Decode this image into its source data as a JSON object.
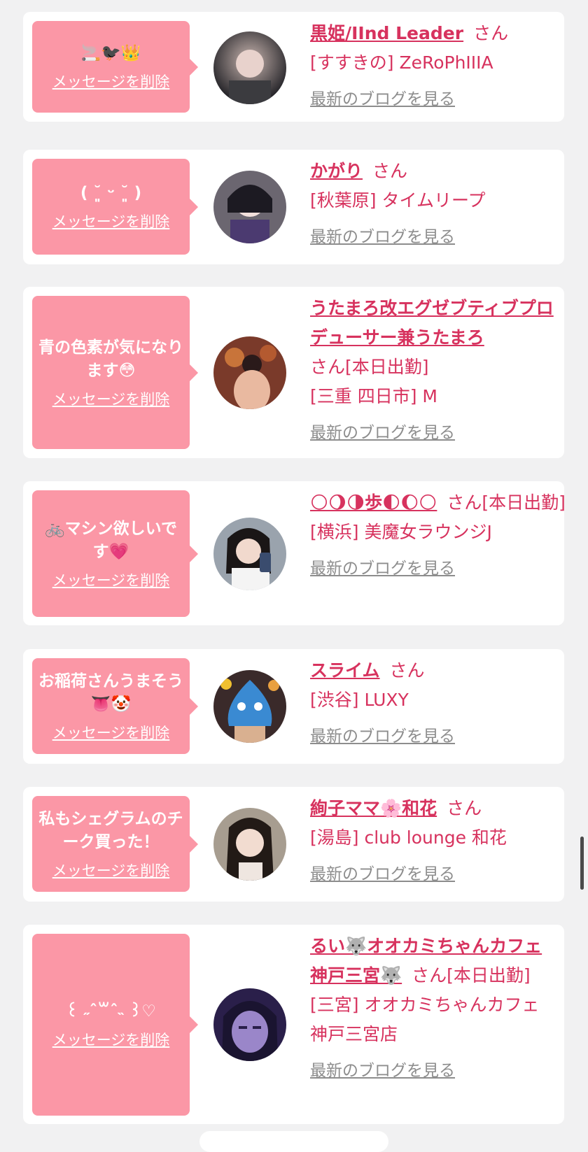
{
  "delete_label": "メッセージを削除",
  "blog_label": "最新のブログを見る",
  "cards": [
    {
      "message": "🚬🐦‍⬛👑",
      "name": "黒姫/IInd Leader",
      "san": "さん",
      "status": "",
      "shop": "[すすきの] ZeRoPhIIIA"
    },
    {
      "message": "( ˘͈ ᵕ ˘͈ )",
      "name": "かがり",
      "san": "さん",
      "status": "",
      "shop": "[秋葉原] タイムリープ"
    },
    {
      "message": "青の色素が気になります😳",
      "name": "うたまろ改エグゼブティブプロデューサー兼うたまろ",
      "san": "さん",
      "status": "[本日出勤]",
      "shop": "[三重 四日市] M"
    },
    {
      "message": "🚲マシン欲しいです💗",
      "name": "🌕🌖🌗歩🌓🌔🌕",
      "san": "さん",
      "status": "[本日出勤]",
      "shop": "[横浜] 美魔女ラウンジJ"
    },
    {
      "message": "お稲荷さんうまそう👅🤡",
      "name": "スライム",
      "san": "さん",
      "status": "",
      "shop": "[渋谷] LUXY"
    },
    {
      "message": "私もシェグラムのチーク買った！",
      "name": "絢子ママ🌸和花",
      "san": "さん",
      "status": "",
      "shop": "[湯島] club lounge 和花"
    },
    {
      "message": "꒰ ˶ˆ꒳ˆ˵ ꒱♡",
      "name": "るい🐺オオカミちゃんカフェ神戸三宮🐺",
      "san": "さん",
      "status": "[本日出勤]",
      "shop": "[三宮] オオカミちゃんカフェ神戸三宮店"
    }
  ]
}
